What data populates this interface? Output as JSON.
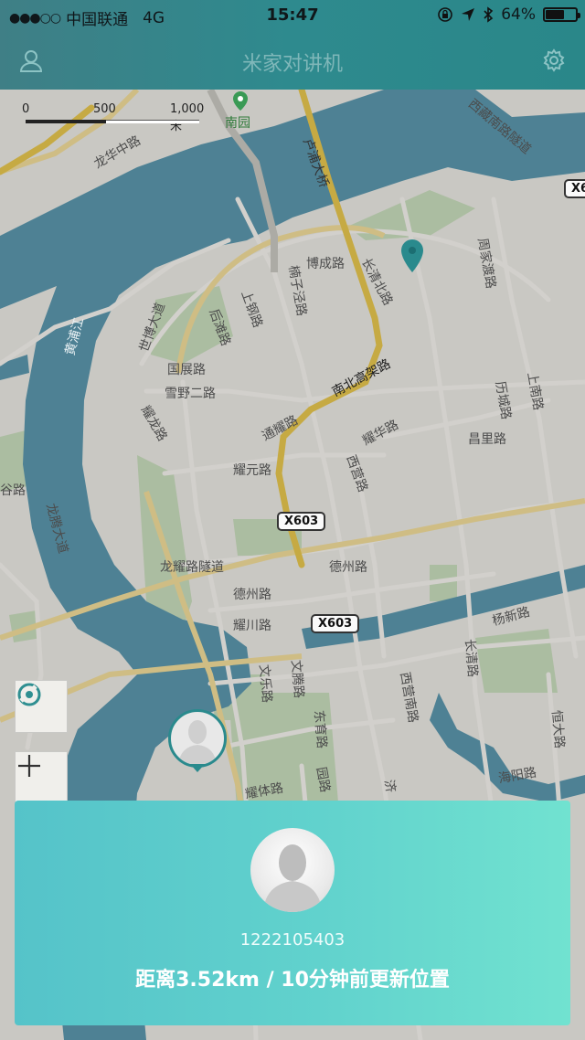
{
  "status_bar": {
    "signal": "●●●○○",
    "carrier": "中国联通",
    "network": "4G",
    "time": "15:47",
    "battery_percent": "64%",
    "battery_level": 0.64
  },
  "nav": {
    "title": "米家对讲机",
    "left_icon": "user-icon",
    "right_icon": "gear-icon"
  },
  "map": {
    "scale": {
      "zero": "0",
      "mid": "500",
      "end": "1,000 米"
    },
    "place_labels": {
      "nanyuan": "南园",
      "longhua_zhonglu": "龙华中路",
      "huangpujiang": "黄浦江",
      "lupu_daqiao": "卢浦大桥",
      "xizang_nanlu": "西藏南路隧道",
      "bocheng_lu": "博成路",
      "changqing_beilu": "长清北路",
      "zhoujiadulu": "周家渡路",
      "shibo_dadao": "世博大道",
      "houtan_lu": "后滩路",
      "shanggang_lu": "上钢路",
      "lanzi_jing_lu": "楠子泾路",
      "guozhan_lu": "国展路",
      "xueye_erlu": "雪野二路",
      "yaolong_lu": "耀龙路",
      "nanbei_gaojia": "南北高架路",
      "tongyao_lu": "通耀路",
      "yaohua_lu": "耀华路",
      "yaoyuan_lu": "耀元路",
      "xiying_lu": "西营路",
      "changli_lu": "昌里路",
      "shangnan_lu": "上南路",
      "li_lu": "历城路",
      "longteng_dadao": "龙腾大道",
      "ri_gu_lu": "谷路",
      "longyao_suidao": "龙耀路隧道",
      "dezhou_lu_1": "德州路",
      "dezhou_lu_2": "德州路",
      "yaochuan_lu": "耀川路",
      "yangxin_lu": "杨新路",
      "changqing_lu": "长清路",
      "xiying_nanlu": "西营南路",
      "wenteng_lu": "文腾路",
      "wenle_lu": "文乐路",
      "dongyu_lu": "东育路",
      "hengda_lu": "恒大路",
      "haiyang_lu": "海阳路",
      "yaoti_lu": "耀体路",
      "ji_lu": "济",
      "yuan_lu": "园路"
    },
    "shields": [
      "X603",
      "X603",
      "X6"
    ],
    "buttons": {
      "locate": "locate-icon",
      "zoom_in": "+"
    }
  },
  "card": {
    "phone": "1222105403",
    "status_text": "距离3.52km / 10分钟前更新位置"
  },
  "colors": {
    "accent": "#2e8a8e",
    "card_start": "#55c3c9",
    "card_end": "#71e2d0",
    "water": "#5b97ad",
    "road_major": "#e7c64e"
  }
}
